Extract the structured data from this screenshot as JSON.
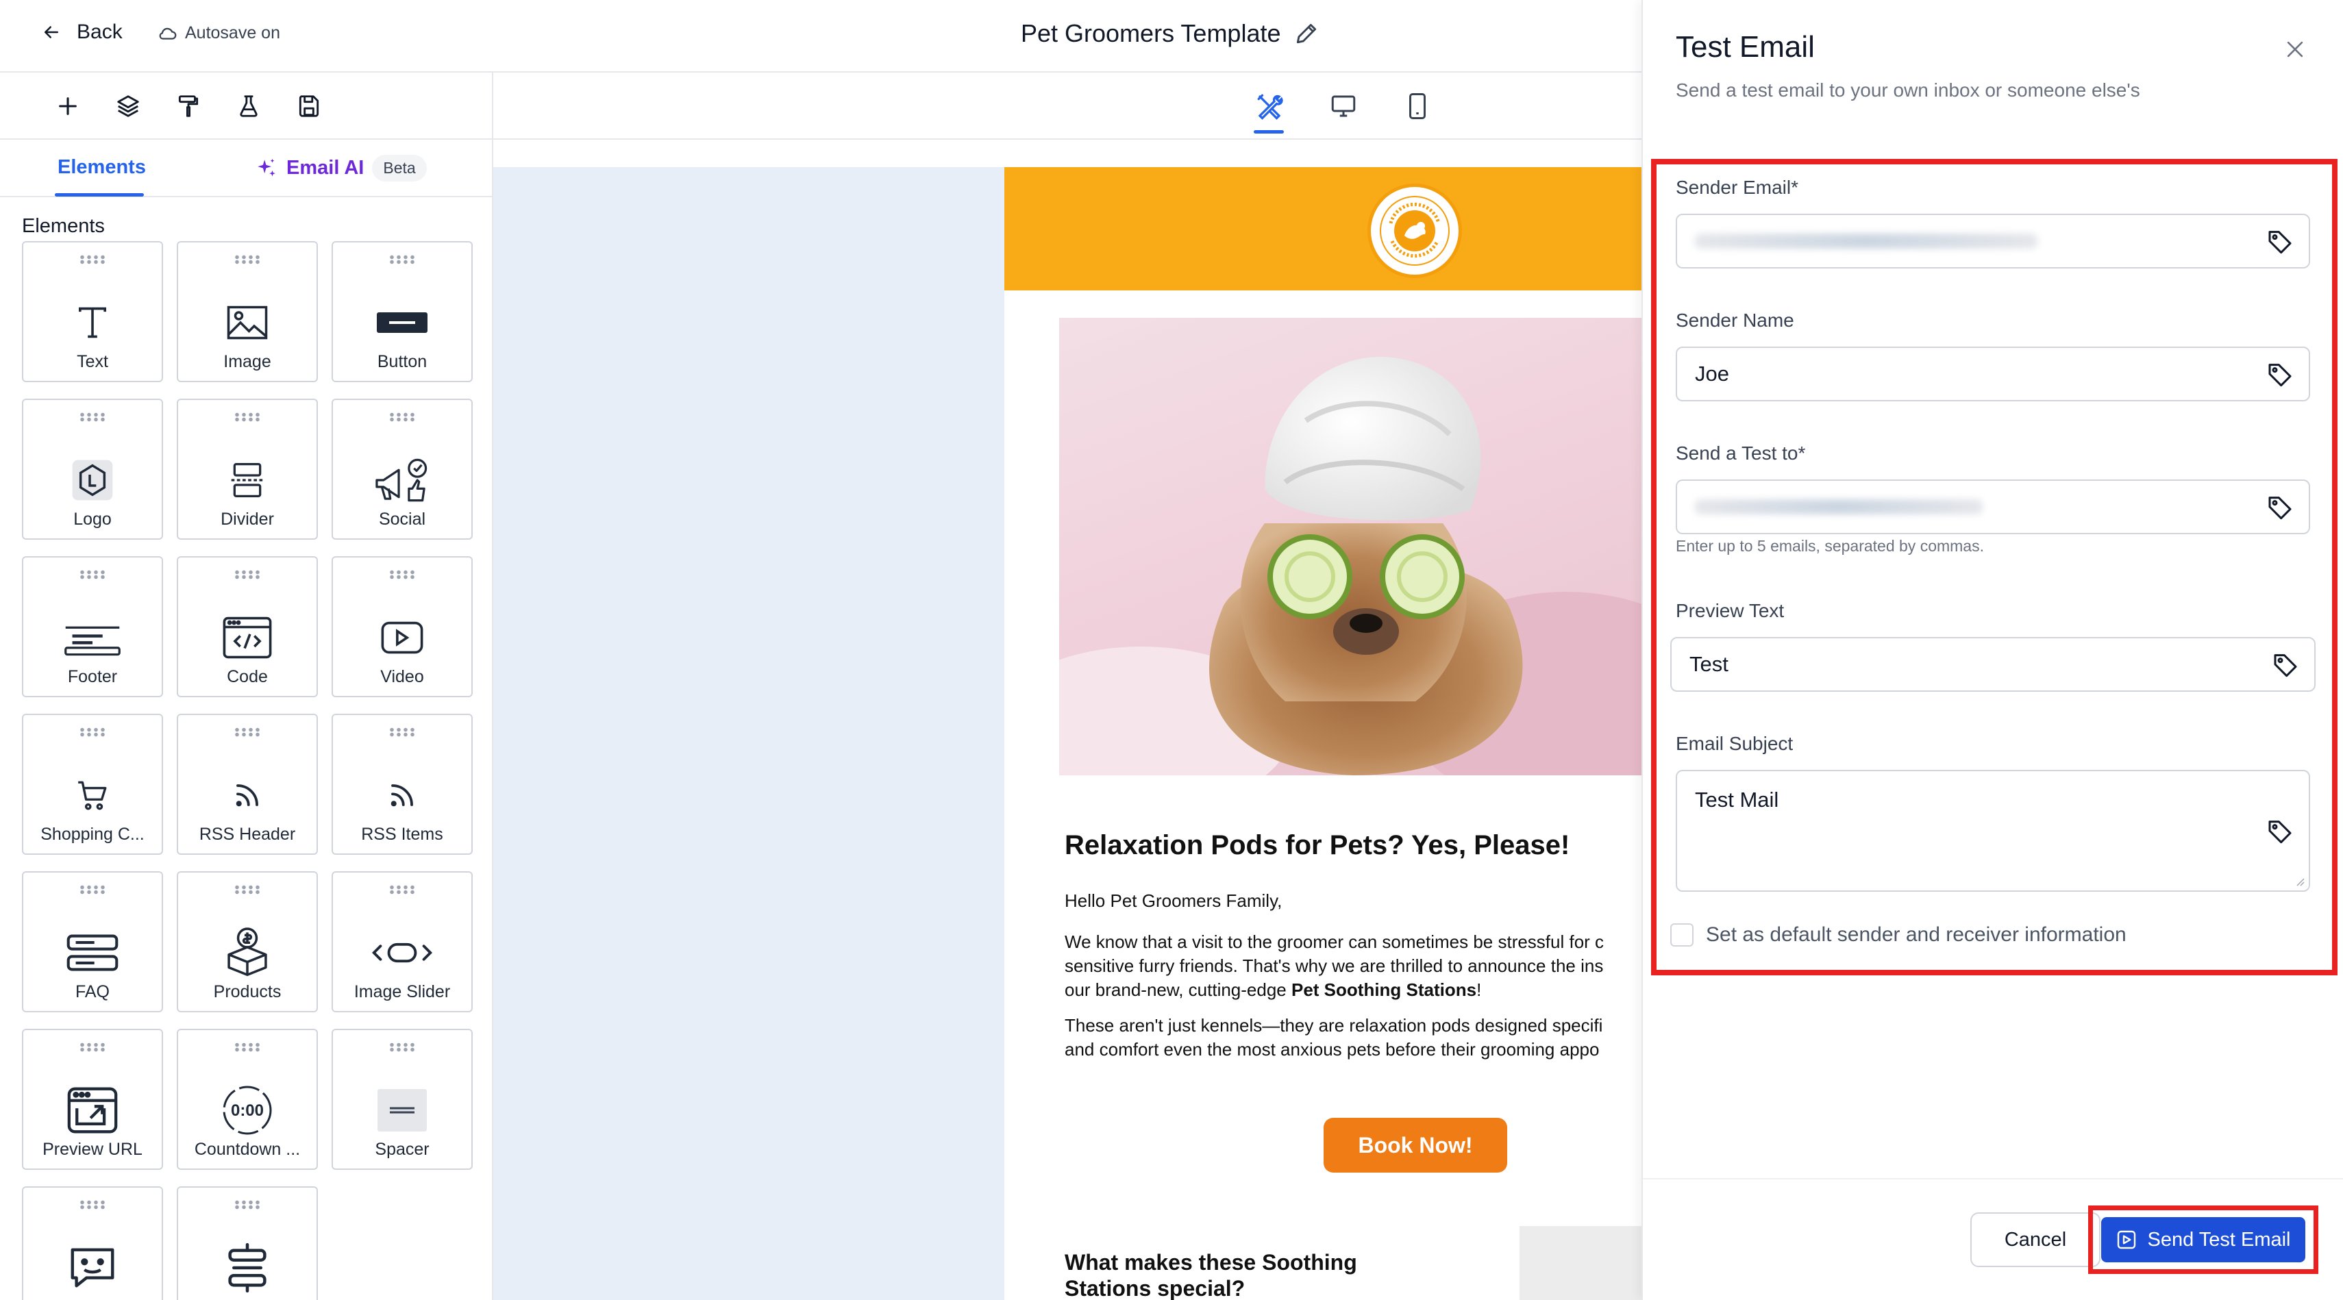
{
  "header": {
    "back_label": "Back",
    "autosave_label": "Autosave on",
    "title": "Pet Groomers Template"
  },
  "left_tabs": {
    "elements_label": "Elements",
    "ai_label": "Email AI",
    "ai_badge": "Beta"
  },
  "elements_panel": {
    "section_label": "Elements",
    "items": [
      {
        "label": "Text",
        "icon": "text-icon"
      },
      {
        "label": "Image",
        "icon": "image-icon"
      },
      {
        "label": "Button",
        "icon": "button-icon"
      },
      {
        "label": "Logo",
        "icon": "logo-icon"
      },
      {
        "label": "Divider",
        "icon": "divider-icon"
      },
      {
        "label": "Social",
        "icon": "social-icon"
      },
      {
        "label": "Footer",
        "icon": "footer-icon"
      },
      {
        "label": "Code",
        "icon": "code-icon"
      },
      {
        "label": "Video",
        "icon": "video-icon"
      },
      {
        "label": "Shopping C...",
        "icon": "cart-icon"
      },
      {
        "label": "RSS Header",
        "icon": "rss-icon"
      },
      {
        "label": "RSS Items",
        "icon": "rss-icon"
      },
      {
        "label": "FAQ",
        "icon": "faq-icon"
      },
      {
        "label": "Products",
        "icon": "products-icon"
      },
      {
        "label": "Image Slider",
        "icon": "slider-icon"
      },
      {
        "label": "Preview URL",
        "icon": "preview-url-icon"
      },
      {
        "label": "Countdown ...",
        "icon": "countdown-icon"
      },
      {
        "label": "Spacer",
        "icon": "spacer-icon"
      },
      {
        "label": "",
        "icon": "chatbot-icon"
      },
      {
        "label": "",
        "icon": "stack-icon"
      }
    ],
    "countdown_text": "0:00"
  },
  "email": {
    "heading": "Relaxation Pods for Pets? Yes, Please!",
    "greeting": "Hello Pet Groomers Family,",
    "para1_line1": "We know that a visit to the groomer can sometimes be stressful for c",
    "para1_line2": "sensitive furry friends. That's why we are thrilled to announce the ins",
    "para1_line3_pre": "our brand-new, cutting-edge ",
    "para1_line3_bold": "Pet Soothing Stations",
    "para1_line3_post": "!",
    "para2_line1": "These aren't just kennels—they are relaxation pods designed specifi",
    "para2_line2": "and comfort even the most anxious pets before their grooming appo",
    "cta_label": "Book Now!",
    "subheading_line1": "What makes these Soothing",
    "subheading_line2": "Stations special?"
  },
  "test_email": {
    "title": "Test Email",
    "subtitle": "Send a test email to your own inbox or someone else's",
    "sender_email_label": "Sender Email*",
    "sender_name_label": "Sender Name",
    "sender_name_value": "Joe",
    "send_to_label": "Send a Test to*",
    "send_to_helper": "Enter up to 5 emails, separated by commas.",
    "preview_text_label": "Preview Text",
    "preview_text_value": "Test",
    "subject_label": "Email Subject",
    "subject_value": "Test Mail",
    "default_checkbox_label": "Set as default sender and receiver information",
    "cancel_label": "Cancel",
    "send_label": "Send Test Email"
  },
  "colors": {
    "accent_blue": "#2563eb",
    "highlight_red": "#ea2121",
    "header_orange": "#f8ab17",
    "cta_orange": "#f07c16",
    "ai_purple": "#6d28d9"
  }
}
